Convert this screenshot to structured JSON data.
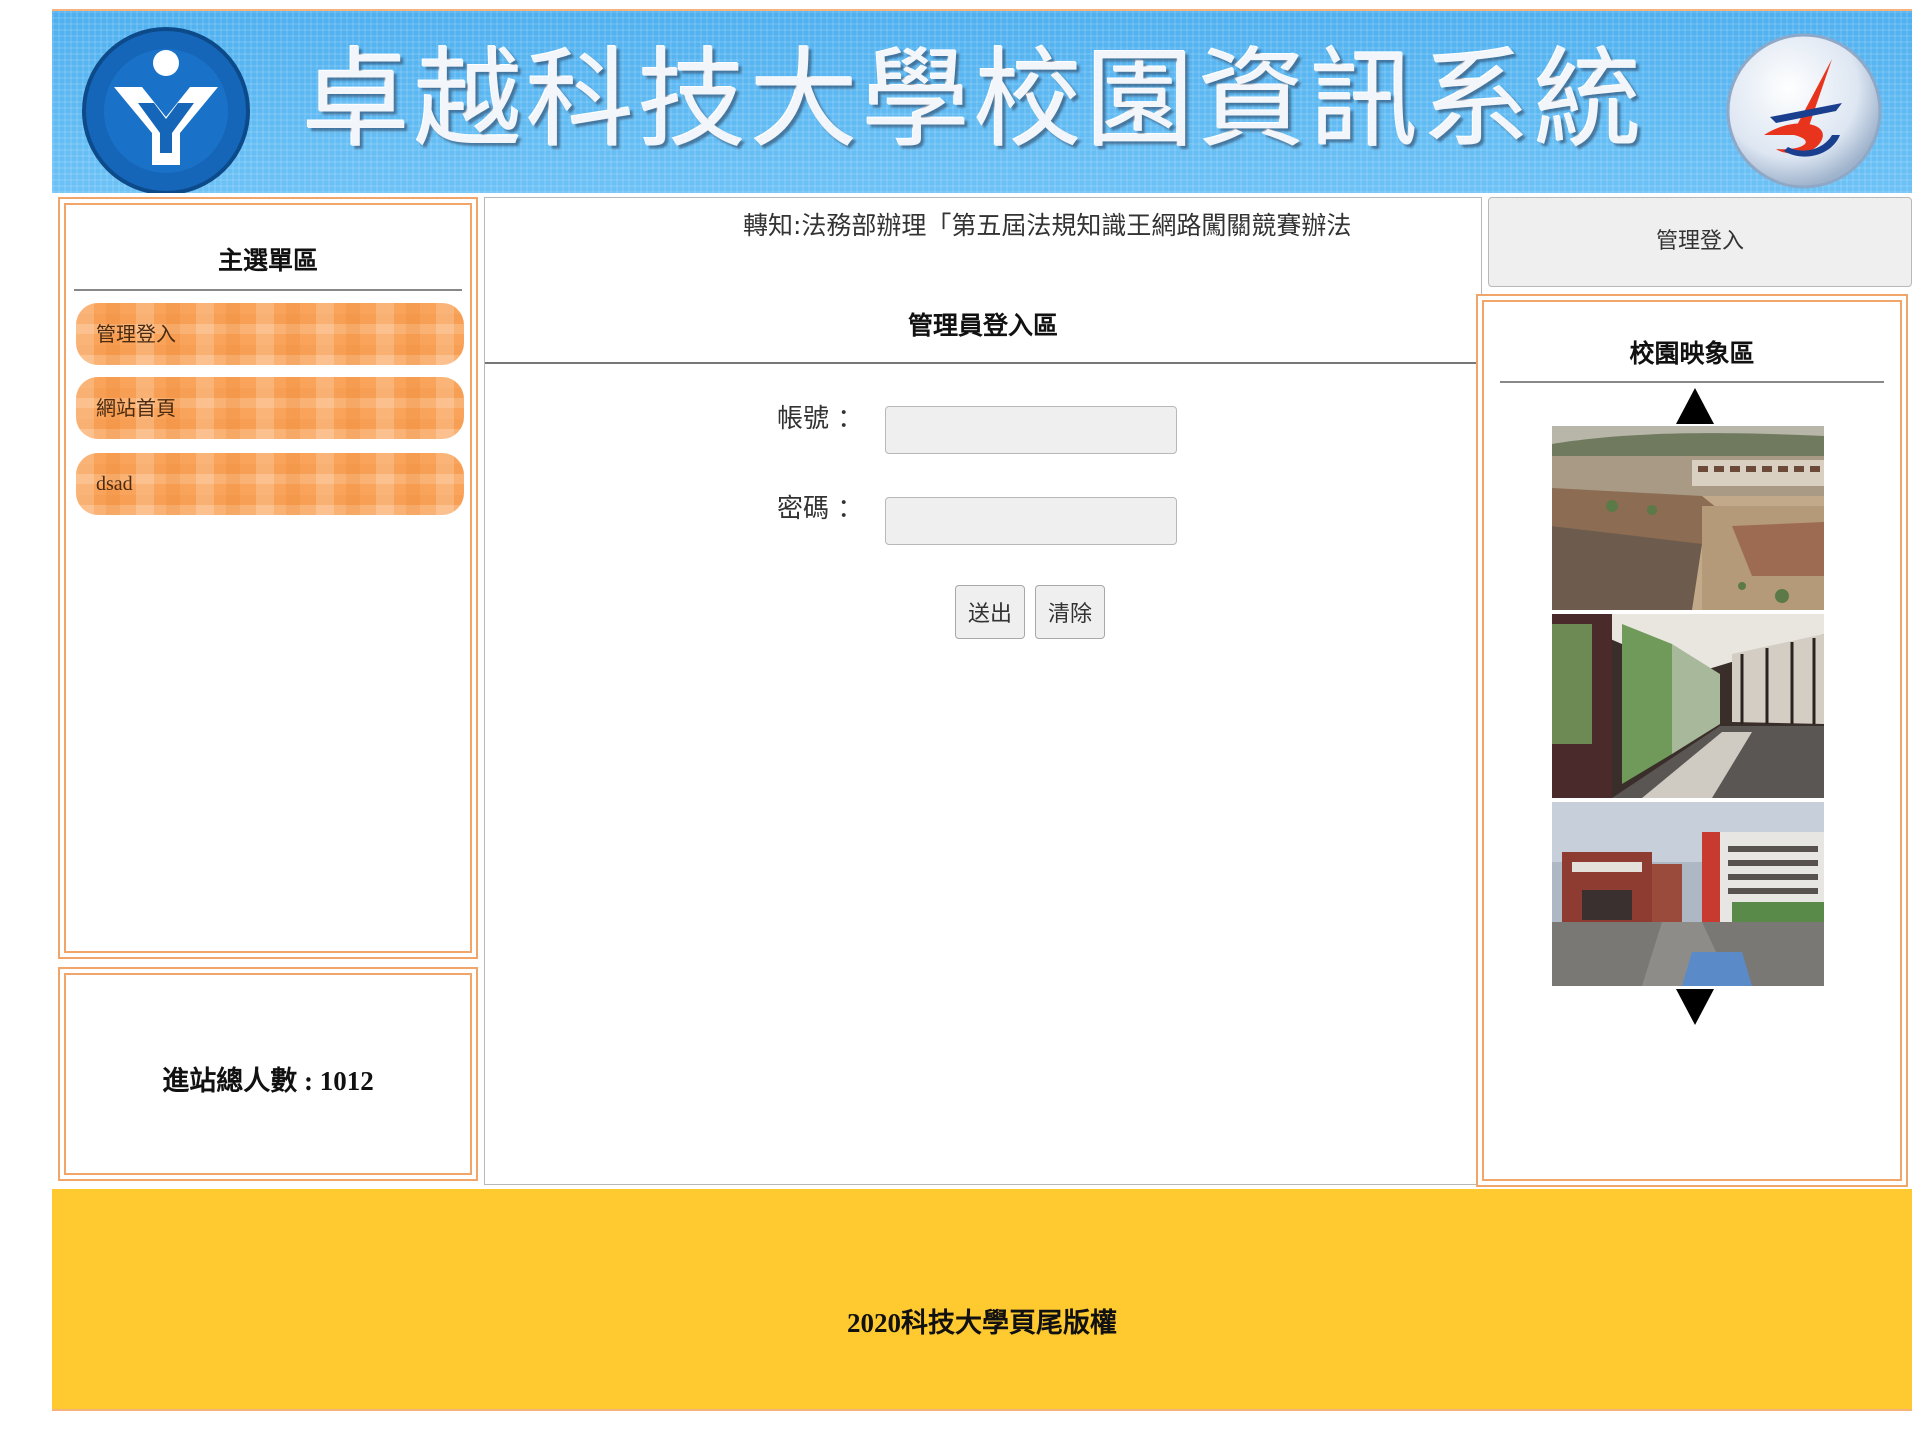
{
  "header": {
    "title": "卓越科技大學校園資訊系統",
    "left_logo_icon": "university-emblem-icon",
    "right_logo_icon": "wda-logo-icon",
    "background_color": "#5bb8f2"
  },
  "sidebar": {
    "title": "主選單區",
    "items": [
      {
        "label": "管理登入"
      },
      {
        "label": "網站首頁"
      },
      {
        "label": "dsad"
      }
    ],
    "button_color": "#f9a45a",
    "frame_color": "#f0a56b"
  },
  "visitors": {
    "label": "進站總人數 : 1012"
  },
  "main": {
    "marquee_text": "轉知:法務部辦理「第五屆法規知識王網路闖關競賽辦法",
    "login_title": "管理員登入區",
    "account_label": "帳號 ：",
    "password_label": "密碼 ：",
    "account_value": "",
    "password_value": "",
    "submit_label": "送出",
    "clear_label": "清除"
  },
  "right_panel": {
    "admin_login_label": "管理登入",
    "campus_title": "校園映象區",
    "up_arrow_icon": "triangle-up-icon",
    "down_arrow_icon": "triangle-down-icon"
  },
  "footer": {
    "text": "2020科技大學頁尾版權",
    "background_color": "#ffc930"
  }
}
